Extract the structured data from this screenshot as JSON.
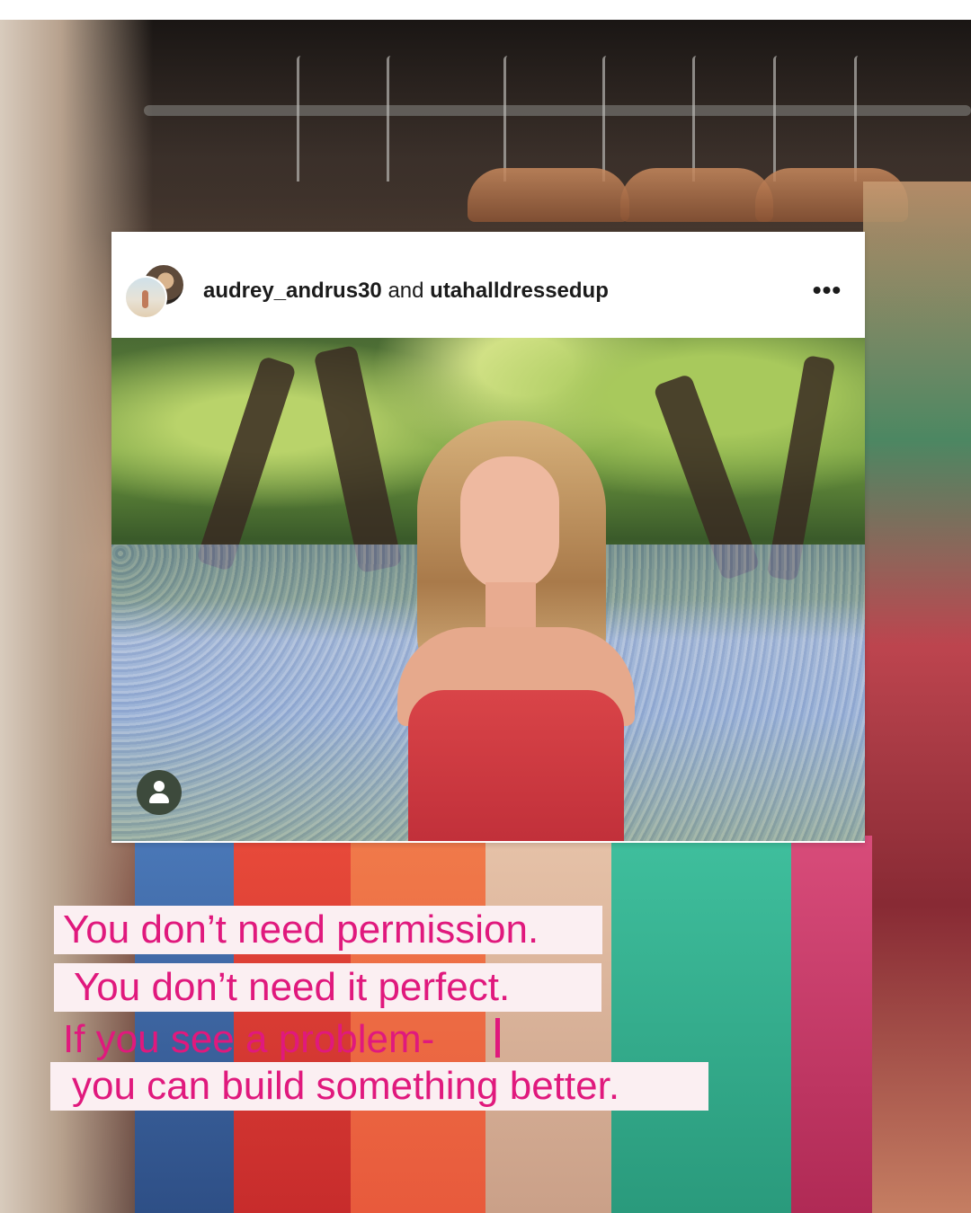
{
  "post": {
    "author_primary": "audrey_andrus30",
    "joiner": "and",
    "author_secondary": "utahalldressedup",
    "more_label": "•••"
  },
  "quote": {
    "line1": "You don’t need permission.",
    "line2": "You don’t need it perfect.",
    "line3": "If you see a problem-",
    "line4": "you can build something better."
  },
  "colors": {
    "quote_text": "#e0197d",
    "quote_highlight": "#fbeff2",
    "card_bg": "#ffffff"
  },
  "icons": [
    "more-options-icon",
    "user-tag-icon"
  ]
}
